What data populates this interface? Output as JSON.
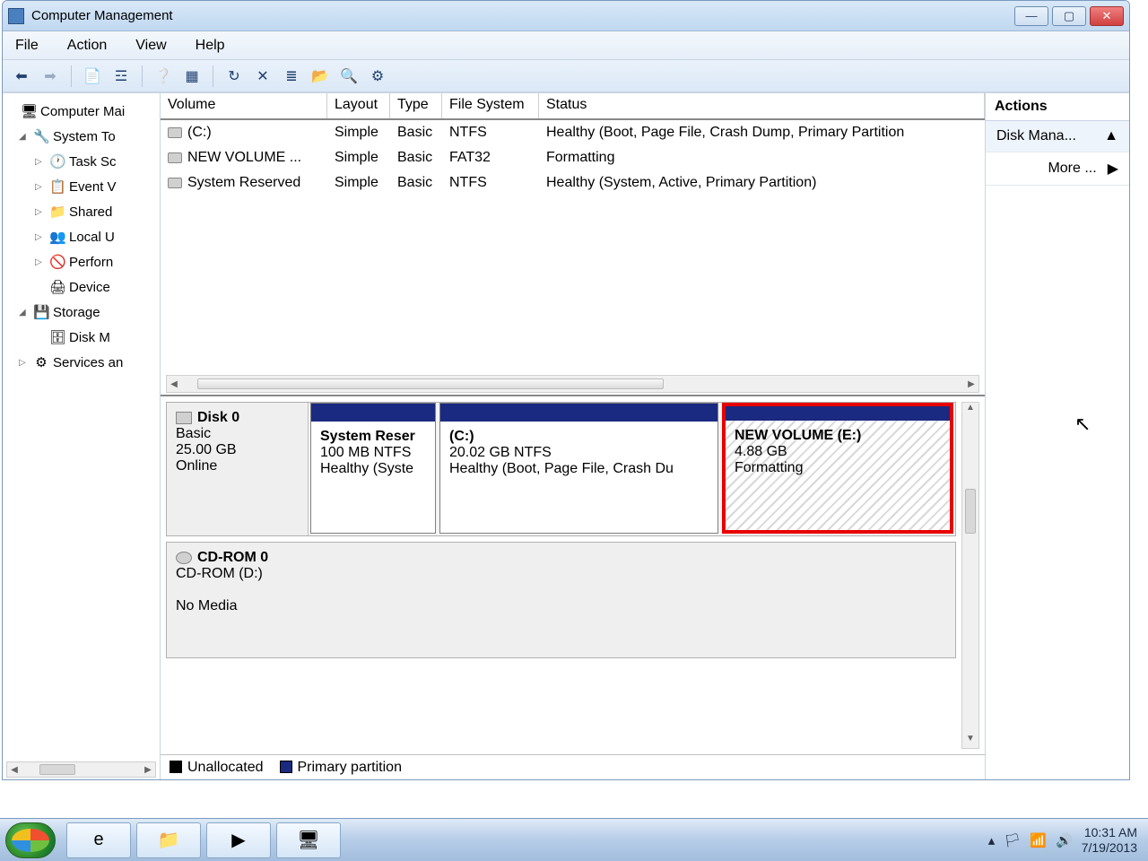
{
  "window": {
    "title": "Computer Management"
  },
  "menu": {
    "file": "File",
    "action": "Action",
    "view": "View",
    "help": "Help"
  },
  "nav": {
    "root": "Computer Mai",
    "systools": "System To",
    "task": "Task Sc",
    "event": "Event V",
    "shared": "Shared",
    "localu": "Local U",
    "perf": "Perforn",
    "device": "Device",
    "storage": "Storage",
    "diskm": "Disk M",
    "services": "Services an"
  },
  "vol_headers": {
    "volume": "Volume",
    "layout": "Layout",
    "type": "Type",
    "fs": "File System",
    "status": "Status"
  },
  "volumes": [
    {
      "name": "(C:)",
      "layout": "Simple",
      "type": "Basic",
      "fs": "NTFS",
      "status": "Healthy (Boot, Page File, Crash Dump, Primary Partition"
    },
    {
      "name": "NEW VOLUME ...",
      "layout": "Simple",
      "type": "Basic",
      "fs": "FAT32",
      "status": "Formatting"
    },
    {
      "name": "System Reserved",
      "layout": "Simple",
      "type": "Basic",
      "fs": "NTFS",
      "status": "Healthy (System, Active, Primary Partition)"
    }
  ],
  "disk0": {
    "label": "Disk 0",
    "type": "Basic",
    "size": "25.00 GB",
    "state": "Online",
    "parts": [
      {
        "title": "System Reser",
        "line2": "100 MB NTFS",
        "line3": "Healthy (Syste"
      },
      {
        "title": "  (C:)",
        "line2": "20.02 GB NTFS",
        "line3": "Healthy (Boot, Page File, Crash Du"
      },
      {
        "title": "NEW VOLUME  (E:)",
        "line2": "4.88 GB",
        "line3": "Formatting"
      }
    ]
  },
  "cdrom": {
    "label": "CD-ROM 0",
    "sub": "CD-ROM (D:)",
    "state": "No Media"
  },
  "legend": {
    "unalloc": "Unallocated",
    "primary": "Primary partition"
  },
  "actions": {
    "header": "Actions",
    "item": "Disk Mana...",
    "more": "More ..."
  },
  "tray": {
    "time": "10:31 AM",
    "date": "7/19/2013"
  }
}
